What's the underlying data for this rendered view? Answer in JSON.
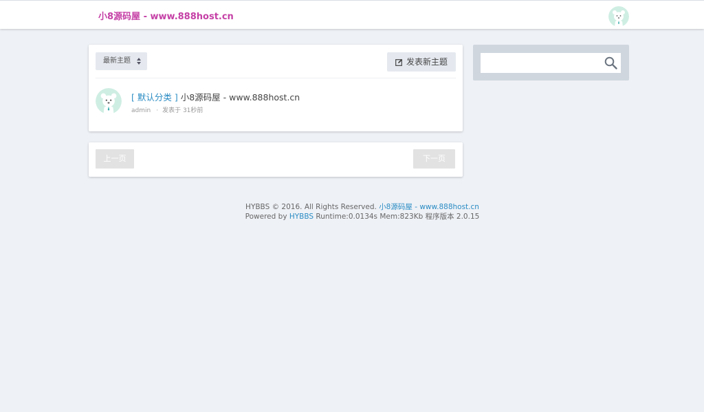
{
  "header": {
    "brand": "小8源码屋 - www.888host.cn"
  },
  "toolbar": {
    "sort_label": "最新主题",
    "new_topic_label": "发表新主题"
  },
  "posts": [
    {
      "category": "[ 默认分类 ]",
      "title": "小8源码屋 - www.888host.cn",
      "author": "admin",
      "sep": "·",
      "time": "发表于 31秒前"
    }
  ],
  "pager": {
    "prev": "上一页",
    "next": "下一页"
  },
  "search": {
    "placeholder": ""
  },
  "footer": {
    "line1_prefix": "HYBBS © 2016. All Rights Reserved.",
    "line1_link": "小8源码屋 - www.888host.cn",
    "line2_prefix": "Powered by",
    "line2_link": "HYBBS",
    "line2_suffix": "Runtime:0.0134s Mem:823Kb 程序版本 2.0.15"
  },
  "colors": {
    "brand": "#c540a6",
    "link": "#2b8cc4",
    "background": "#eef1f6"
  },
  "icons": [
    "bear-avatar-icon",
    "sort-caret-icon",
    "edit-icon",
    "search-icon"
  ]
}
